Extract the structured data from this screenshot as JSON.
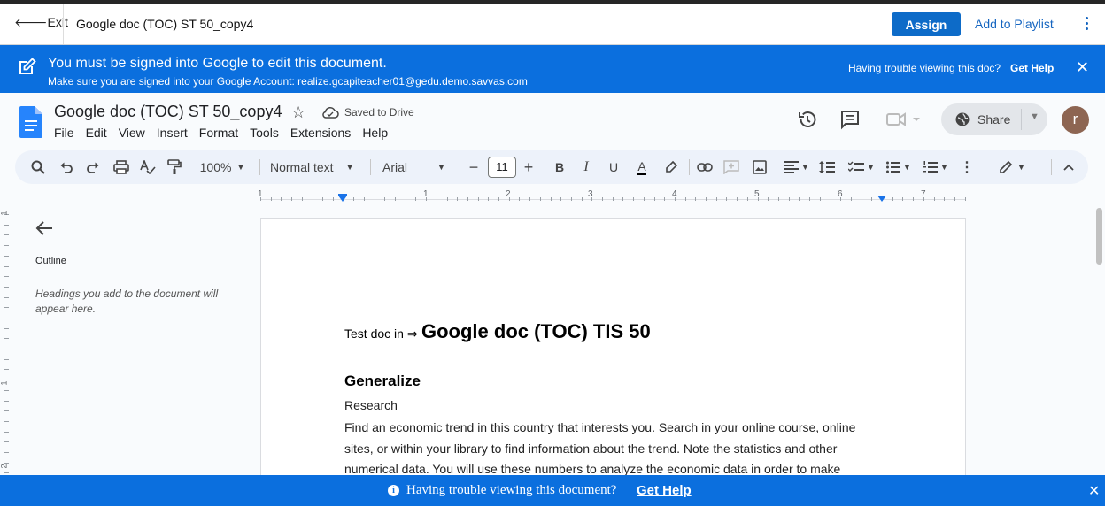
{
  "appbar": {
    "exit_label": "Exit",
    "title": "Google doc (TOC) ST 50_copy4",
    "assign_label": "Assign",
    "playlist_label": "Add to Playlist"
  },
  "banner": {
    "main": "You must be signed into Google to edit this document.",
    "sub": "Make sure you are signed into your Google Account: realize.gcapiteacher01@gedu.demo.savvas.com",
    "trouble": "Having trouble viewing this doc?",
    "help": "Get Help"
  },
  "docs": {
    "title": "Google doc (TOC) ST 50_copy4",
    "saved": "Saved to Drive",
    "menu": [
      "File",
      "Edit",
      "View",
      "Insert",
      "Format",
      "Tools",
      "Extensions",
      "Help"
    ],
    "share_label": "Share",
    "avatar_letter": "r"
  },
  "toolbar": {
    "zoom": "100%",
    "style": "Normal text",
    "font": "Arial",
    "font_size": "11",
    "bold": "B",
    "italic": "I",
    "underline": "U",
    "text_color": "A"
  },
  "ruler": {
    "numbers": [
      "1",
      "1",
      "2",
      "3",
      "4",
      "5",
      "6",
      "7"
    ]
  },
  "outline": {
    "label": "Outline",
    "hint": "Headings you add to the document will appear here."
  },
  "page": {
    "intro_small": "Test doc in ⇒",
    "intro_big": "Google doc (TOC) TIS 50",
    "heading": "Generalize",
    "subheading": "Research",
    "body": "Find an economic trend in this country that interests you. Search in your online course, online sites, or within your library to find information about the trend. Note the statistics and other numerical data. You will use these numbers to analyze the economic data in order to make"
  },
  "bottom_banner": {
    "text": "Having trouble viewing this document?",
    "help": "Get Help"
  },
  "colors": {
    "banner_blue": "#0b6fde",
    "assign_blue": "#0d6bc8",
    "link_blue": "#1565c0",
    "avatar_brown": "#8d6552"
  }
}
